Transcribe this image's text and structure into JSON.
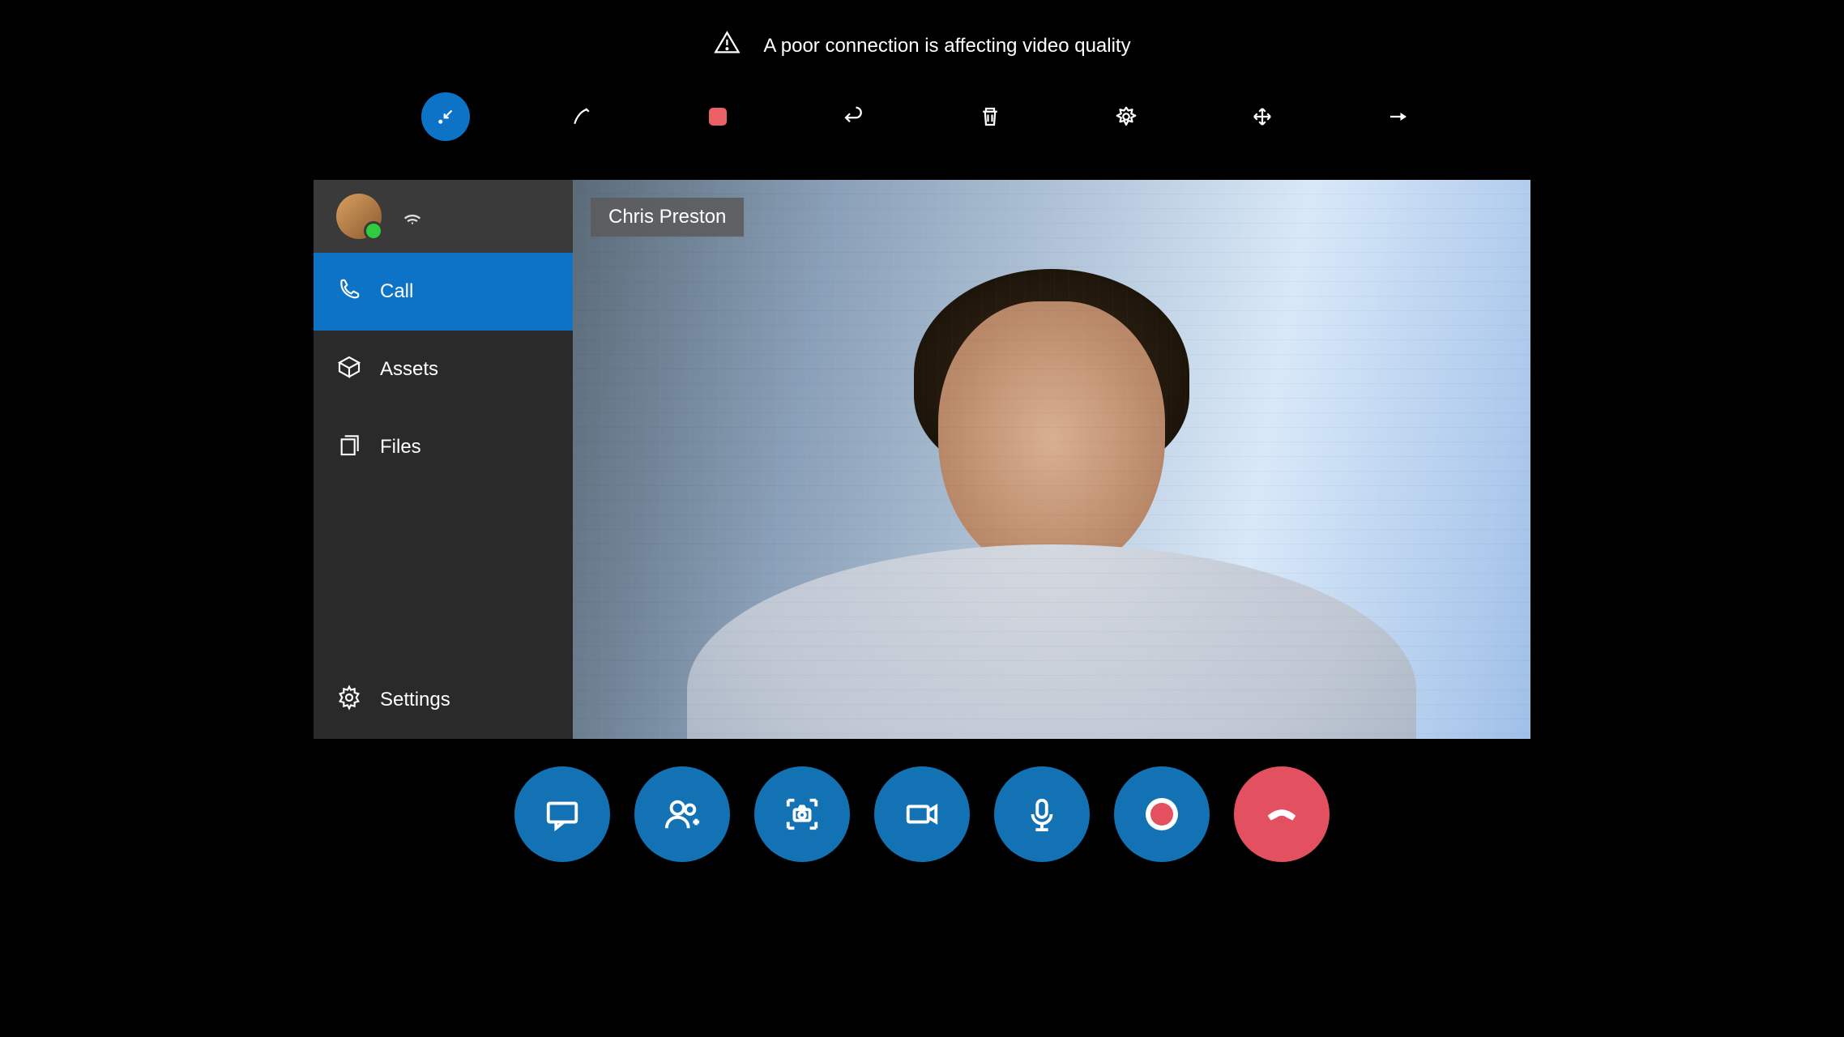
{
  "banner": {
    "text": "A poor connection is affecting video quality"
  },
  "toolbar": {
    "collapse": "collapse",
    "annotate": "annotate",
    "stop_record": "stop",
    "undo": "undo",
    "delete": "delete",
    "effects": "effects",
    "expand": "expand",
    "pin": "pin"
  },
  "sidebar": {
    "items": [
      {
        "label": "Call"
      },
      {
        "label": "Assets"
      },
      {
        "label": "Files"
      },
      {
        "label": "Settings"
      }
    ]
  },
  "video": {
    "participant_name": "Chris Preston"
  },
  "controls": {
    "chat": "chat",
    "add_participant": "add participant",
    "snapshot": "snapshot",
    "camera": "camera",
    "mic": "microphone",
    "record": "record",
    "hangup": "hang up"
  }
}
